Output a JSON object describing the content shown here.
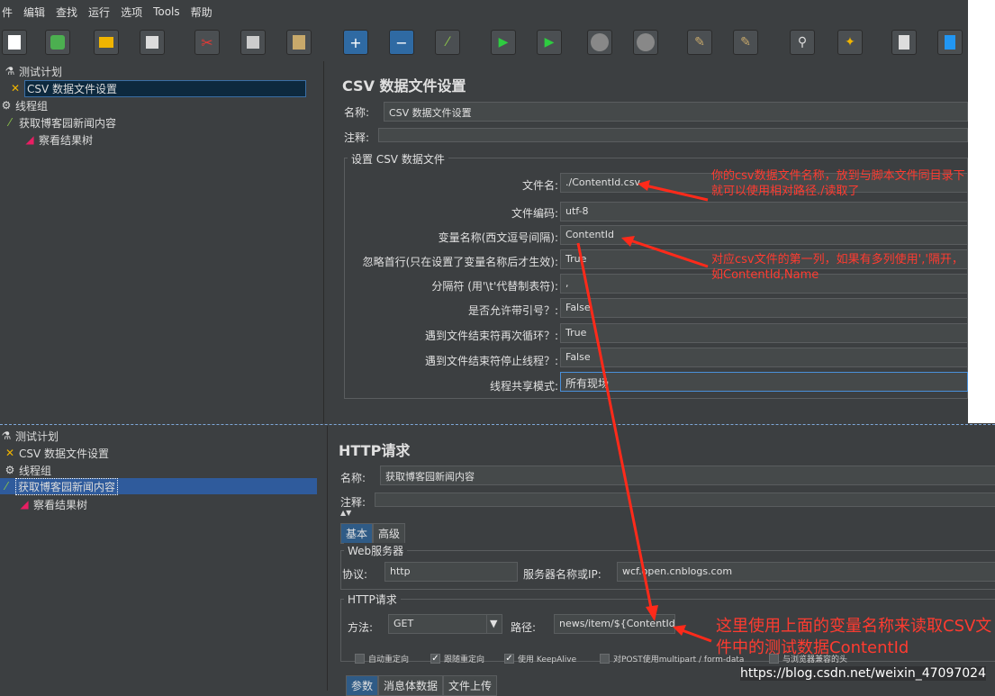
{
  "menu": [
    "件",
    "编辑",
    "查找",
    "运行",
    "选项",
    "Tools",
    "帮助"
  ],
  "toolbar_icons": [
    "new-icon",
    "template-icon",
    "open-icon",
    "save-icon",
    "cut-icon",
    "copy-icon",
    "paste-icon",
    "expand-icon",
    "collapse-icon",
    "toggle-icon",
    "start-icon",
    "start-no-pause-icon",
    "stop-icon",
    "shutdown-icon",
    "clear-icon",
    "clear-all-icon",
    "search-icon",
    "reset-search-icon",
    "function-helper-icon",
    "help-icon"
  ],
  "tree_top": {
    "items": [
      "测试计划",
      "CSV 数据文件设置",
      "线程组",
      "获取博客园新闻内容",
      "察看结果树"
    ]
  },
  "csv": {
    "title": "CSV 数据文件设置",
    "name_label": "名称:",
    "name_value": "CSV 数据文件设置",
    "comment_label": "注释:",
    "group_title": "设置 CSV 数据文件",
    "rows": [
      {
        "label": "文件名:",
        "value": "./ContentId.csv"
      },
      {
        "label": "文件编码:",
        "value": "utf-8"
      },
      {
        "label": "变量名称(西文逗号间隔):",
        "value": "ContentId"
      },
      {
        "label": "忽略首行(只在设置了变量名称后才生效):",
        "value": "True"
      },
      {
        "label": "分隔符 (用'\\t'代替制表符):",
        "value": ","
      },
      {
        "label": "是否允许带引号？:",
        "value": "False"
      },
      {
        "label": "遇到文件结束符再次循环？:",
        "value": "True"
      },
      {
        "label": "遇到文件结束符停止线程？:",
        "value": "False"
      },
      {
        "label": "线程共享模式:",
        "value": "所有现场"
      }
    ]
  },
  "tree_bottom": {
    "items": [
      "测试计划",
      "CSV 数据文件设置",
      "线程组",
      "获取博客园新闻内容",
      "察看结果树"
    ]
  },
  "http": {
    "title": "HTTP请求",
    "name_label": "名称:",
    "name_value": "获取博客园新闻内容",
    "comment_label": "注释:",
    "tabs": [
      "基本",
      "高级"
    ],
    "web_group": "Web服务器",
    "protocol_label": "协议:",
    "protocol_value": "http",
    "server_label": "服务器名称或IP:",
    "server_value": "wcf.open.cnblogs.com",
    "http_group": "HTTP请求",
    "method_label": "方法:",
    "method_value": "GET",
    "path_label": "路径:",
    "path_value": "news/item/${ContentId}",
    "checks": [
      {
        "label": "自动重定向",
        "checked": false
      },
      {
        "label": "跟随重定向",
        "checked": true
      },
      {
        "label": "使用 KeepAlive",
        "checked": true
      },
      {
        "label": "对POST使用multipart / form-data",
        "checked": false
      },
      {
        "label": "与浏览器兼容的头",
        "checked": false
      }
    ],
    "bottom_tabs": [
      "参数",
      "消息体数据",
      "文件上传"
    ]
  },
  "annotations": {
    "a1": "你的csv数据文件名称，放到与脚本文件同目录下就可以使用相对路径./读取了",
    "a2": "对应csv文件的第一列，如果有多列使用','隔开，如ContentId,Name",
    "a3": "这里使用上面的变量名称来读取CSV文件中的测试数据ContentId"
  },
  "watermark": "https://blog.csdn.net/weixin_47097024"
}
